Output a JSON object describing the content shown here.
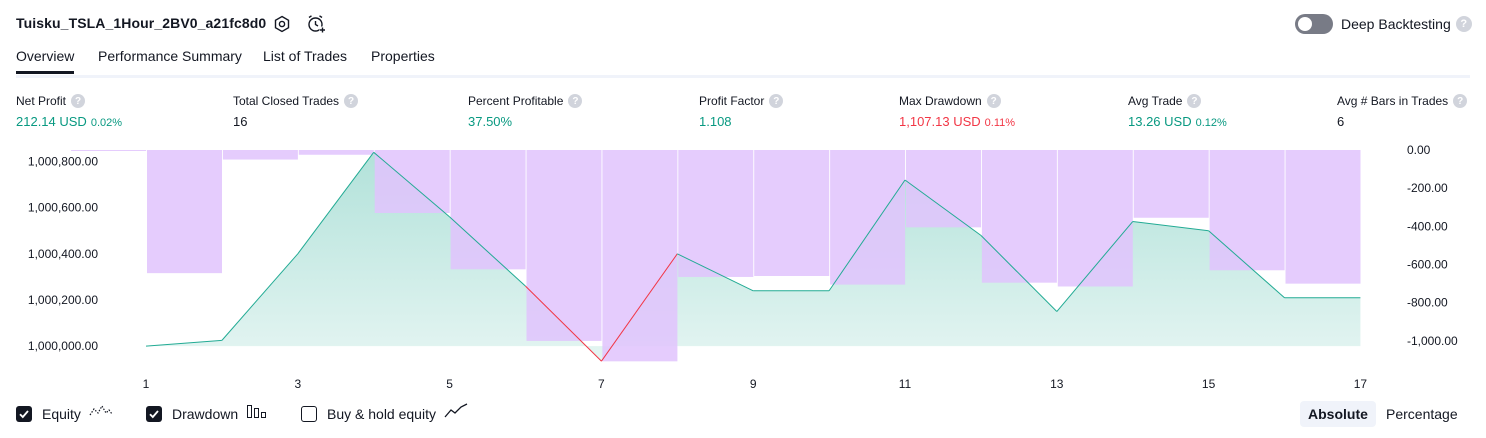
{
  "header": {
    "strategy_name": "Tuisku_TSLA_1Hour_2BV0_a21fc8d0",
    "settings_icon": "gear-icon",
    "alert_icon": "alarm-clock-plus-icon",
    "deep_backtesting_label": "Deep Backtesting",
    "deep_backtesting_enabled": false,
    "help_glyph": "?"
  },
  "tabs": [
    {
      "label": "Overview",
      "active": true
    },
    {
      "label": "Performance Summary",
      "active": false
    },
    {
      "label": "List of Trades",
      "active": false
    },
    {
      "label": "Properties",
      "active": false
    }
  ],
  "metrics": [
    {
      "label": "Net Profit",
      "value": "212.14 USD",
      "pct": "0.02%",
      "color": "green"
    },
    {
      "label": "Total Closed Trades",
      "value": "16",
      "pct": "",
      "color": "dark"
    },
    {
      "label": "Percent Profitable",
      "value": "37.50%",
      "pct": "",
      "color": "green"
    },
    {
      "label": "Profit Factor",
      "value": "1.108",
      "pct": "",
      "color": "green"
    },
    {
      "label": "Max Drawdown",
      "value": "1,107.13 USD",
      "pct": "0.11%",
      "color": "red"
    },
    {
      "label": "Avg Trade",
      "value": "13.26 USD",
      "pct": "0.12%",
      "color": "green"
    },
    {
      "label": "Avg # Bars in Trades",
      "value": "6",
      "pct": "",
      "color": "dark"
    }
  ],
  "legend": {
    "equity": {
      "label": "Equity",
      "checked": true,
      "icon": "equity-line-icon"
    },
    "drawdown": {
      "label": "Drawdown",
      "checked": true,
      "icon": "drawdown-bars-icon"
    },
    "buy_hold": {
      "label": "Buy & hold equity",
      "checked": false,
      "icon": "buy-hold-line-icon"
    }
  },
  "view_modes": [
    {
      "label": "Absolute",
      "active": true
    },
    {
      "label": "Percentage",
      "active": false
    }
  ],
  "colors": {
    "equity_line": "#22ab94",
    "equity_loss_line": "#f23645",
    "drawdown_fill": "#e1c3fd",
    "text_green": "#089981",
    "text_red": "#f23645"
  },
  "chart_data": {
    "type": "area",
    "x_ticks": [
      "1",
      "3",
      "5",
      "7",
      "9",
      "11",
      "13",
      "15",
      "17"
    ],
    "left_axis": {
      "label": "",
      "ticks": [
        "1,000,800.00",
        "1,000,600.00",
        "1,000,400.00",
        "1,000,200.00",
        "1,000,000.00"
      ],
      "tick_values": [
        1000800,
        1000600,
        1000400,
        1000200,
        1000000
      ],
      "ylim": [
        999940,
        1000850
      ]
    },
    "right_axis": {
      "label": "",
      "ticks": [
        "0.00",
        "-200.00",
        "-400.00",
        "-600.00",
        "-800.00",
        "-1,000.00"
      ],
      "tick_values": [
        0,
        -200,
        -400,
        -600,
        -800,
        -1000
      ],
      "ylim": [
        -1100,
        0
      ]
    },
    "series": [
      {
        "name": "Equity",
        "kind": "area",
        "x": [
          1,
          2,
          3,
          4,
          5,
          6,
          7,
          8,
          9,
          10,
          11,
          12,
          13,
          14,
          15,
          16,
          17
        ],
        "values": [
          1000000,
          1000025,
          1000400,
          1000840,
          1000560,
          1000260,
          999935,
          1000400,
          1000240,
          1000240,
          1000720,
          1000480,
          1000150,
          1000540,
          1000500,
          1000210,
          1000210
        ]
      },
      {
        "name": "Drawdown",
        "kind": "bar",
        "x": [
          1,
          2,
          3,
          4,
          5,
          6,
          7,
          8,
          9,
          10,
          11,
          12,
          13,
          14,
          15,
          16,
          17
        ],
        "values": [
          -5,
          -645,
          -50,
          -25,
          -330,
          -625,
          -1000,
          -1107,
          -665,
          -660,
          -705,
          -405,
          -695,
          -715,
          -355,
          -630,
          -700
        ]
      }
    ],
    "grid": false
  }
}
